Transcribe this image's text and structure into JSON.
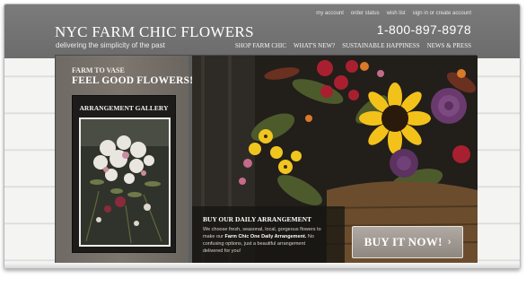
{
  "utility_nav": [
    "my account",
    "order status",
    "wish list",
    "sign in or create account"
  ],
  "brand": {
    "title": "NYC FARM CHIC FLOWERS",
    "tagline": "delivering the simplicity of the past"
  },
  "phone": "1-800-897-8978",
  "main_nav": [
    "SHOP FARM CHIC",
    "WHAT'S NEW?",
    "SUSTAINABLE HAPPINESS",
    "NEWS & PRESS"
  ],
  "promo": {
    "small": "FARM TO VASE",
    "big": "FEEL GOOD FLOWERS!"
  },
  "gallery": {
    "title": "ARRANGEMENT GALLERY"
  },
  "hero": {
    "heading": "BUY OUR DAILY ARRANGEMENT",
    "body_intro": "We choose fresh, seasonal, local, gorgeous flowers to make our ",
    "body_bold": "Farm Chic One Daily Arrangement.",
    "body_outro": " No confusing options, just a beautiful arrangement delivered for you!",
    "cta_label": "BUY IT NOW!",
    "cta_arrow": "›"
  },
  "colors": {
    "header_bg": "#6c6c6c",
    "content_bg": "#5e5e5e",
    "cta_bg": "#9d968f",
    "sunflower": "#f3c21a",
    "rose_red": "#b3283a",
    "purple": "#6a3a6e"
  },
  "icons": {
    "cta_arrow": "chevron-right-icon"
  }
}
